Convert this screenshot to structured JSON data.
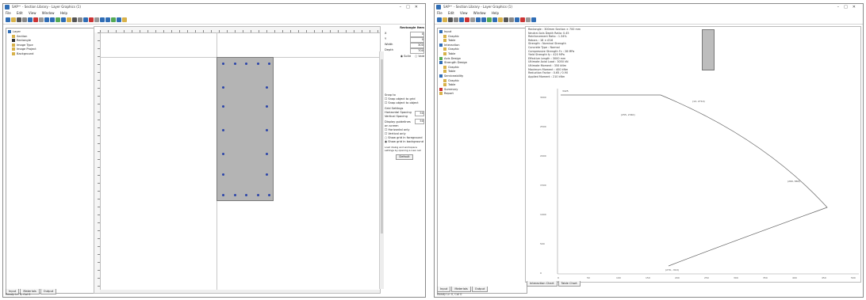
{
  "left": {
    "title": "SAP™ - Section Library - Layer Graphics (1)",
    "menu": [
      "File",
      "Edit",
      "View",
      "Window",
      "Help"
    ],
    "tree": [
      "Layer",
      "Section",
      "Rectangle",
      "Image Type",
      "Image Project",
      "Background"
    ],
    "tabs": [
      "Input",
      "Materials",
      "Output"
    ],
    "status": "Ready  Ln 0, Col 0",
    "props": {
      "header": "Rectangle Item",
      "rows": [
        {
          "label": "X",
          "value": "0"
        },
        {
          "label": "Y",
          "value": "0"
        },
        {
          "label": "Width",
          "value": "300"
        },
        {
          "label": "Depth",
          "value": "700"
        }
      ],
      "radio_solid": "Solid",
      "radio_void": "Void",
      "snap_header": "Snap to",
      "snap_grid": "Snap object to grid",
      "snap_object": "Snap object to object",
      "grid_header": "Grid Settings",
      "h_spacing_label": "Horizontal Spacing",
      "h_spacing": "50",
      "v_spacing_label": "Vertical Spacing",
      "v_spacing": "50",
      "guides_header": "Display guidelines on screen",
      "horizontal": "Horizontal only",
      "vertical": "Vertical only",
      "show_grid": "Show grid in foreground",
      "show_grid_bg": "Show grid in background",
      "note": "Load dialog and workspace settings by opening a new cell",
      "default_btn": "Default"
    }
  },
  "right": {
    "title": "SAP™ - Section Library - Layer Graphics (1)",
    "menu": [
      "File",
      "Edit",
      "View",
      "Window",
      "Help"
    ],
    "tree": [
      "Input",
      "Graphic",
      "Table",
      "Interaction",
      "Graphic",
      "Table",
      "Axis Design",
      "Strength Design",
      "Graphic",
      "Table",
      "Serviceability",
      "Graphic",
      "Table",
      "Summary",
      "Report"
    ],
    "tabs": [
      "Input",
      "Materials",
      "Output"
    ],
    "bottom_tabs": [
      "Interaction Chart",
      "Table Chart"
    ],
    "status": "Ready  Ln 0, Col 0",
    "info": [
      "Rectangle : 300mm Section × 700 mm",
      "Neutral Axis Depth Ratio: 0.45",
      "Reinforcement Ratio : 1.34%",
      "Rebars : 18 × Ø16",
      "Strength : Nominal Strength",
      "Concrete Type : Normal",
      "Compressive Strength f'c : 28 MPa",
      "Yield Strength fy : 420 MPa",
      "Effective Length : 3000 mm",
      "Ultimate Axial Load : 3050 kN",
      "Ultimate Moment : 350 kNm",
      "Maximum Moment : 400 kNm",
      "Reduction Factor : 0.65 / 0.90",
      "Applied Moment : 210 kNm"
    ],
    "plot_labels": [
      "3425",
      "(12, 2710)",
      "(255, 2340)",
      "(260, 860)",
      "(270, -310)"
    ],
    "y_ticks": [
      "3000",
      "2500",
      "2000",
      "1500",
      "1000",
      "500",
      "0"
    ],
    "x_ticks": [
      "0",
      "50",
      "100",
      "150",
      "200",
      "250",
      "300",
      "350",
      "400",
      "450",
      "500"
    ]
  },
  "colors": {
    "section": "#b4b4b4",
    "rebar": "#2b44a8",
    "toolbar_blue": "#2f6db5",
    "toolbar_yellow": "#d8b24a"
  }
}
